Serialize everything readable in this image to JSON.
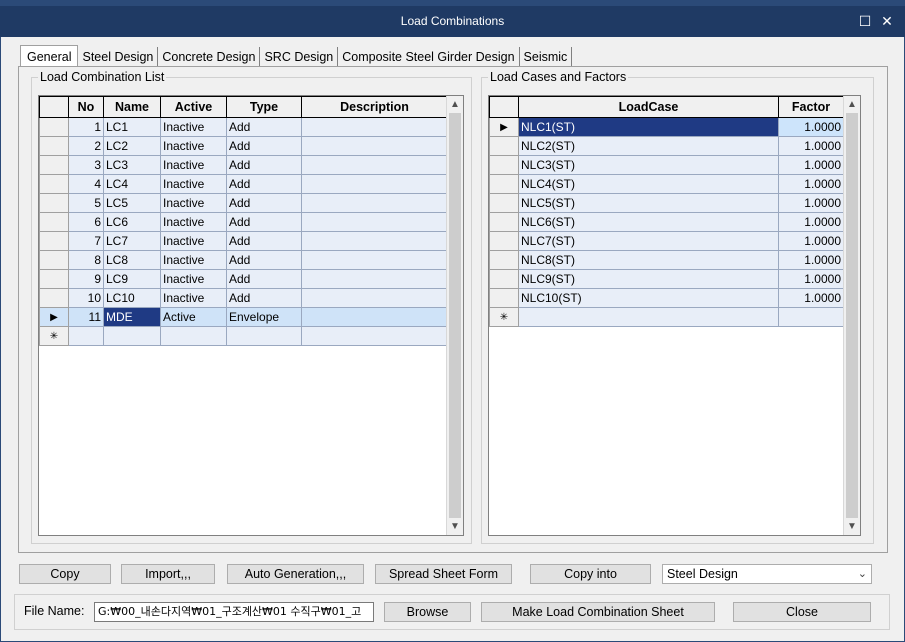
{
  "window": {
    "title": "Load Combinations"
  },
  "tabs": [
    "General",
    "Steel Design",
    "Concrete Design",
    "SRC Design",
    "Composite Steel Girder Design",
    "Seismic"
  ],
  "combo_list": {
    "label": "Load Combination List",
    "columns": [
      "No",
      "Name",
      "Active",
      "Type",
      "Description"
    ],
    "rows": [
      {
        "no": "1",
        "name": "LC1",
        "active": "Inactive",
        "type": "Add",
        "desc": ""
      },
      {
        "no": "2",
        "name": "LC2",
        "active": "Inactive",
        "type": "Add",
        "desc": ""
      },
      {
        "no": "3",
        "name": "LC3",
        "active": "Inactive",
        "type": "Add",
        "desc": ""
      },
      {
        "no": "4",
        "name": "LC4",
        "active": "Inactive",
        "type": "Add",
        "desc": ""
      },
      {
        "no": "5",
        "name": "LC5",
        "active": "Inactive",
        "type": "Add",
        "desc": ""
      },
      {
        "no": "6",
        "name": "LC6",
        "active": "Inactive",
        "type": "Add",
        "desc": ""
      },
      {
        "no": "7",
        "name": "LC7",
        "active": "Inactive",
        "type": "Add",
        "desc": ""
      },
      {
        "no": "8",
        "name": "LC8",
        "active": "Inactive",
        "type": "Add",
        "desc": ""
      },
      {
        "no": "9",
        "name": "LC9",
        "active": "Inactive",
        "type": "Add",
        "desc": ""
      },
      {
        "no": "10",
        "name": "LC10",
        "active": "Inactive",
        "type": "Add",
        "desc": ""
      },
      {
        "no": "11",
        "name": "MDE",
        "active": "Active",
        "type": "Envelope",
        "desc": ""
      }
    ],
    "selected_row": 10
  },
  "cases": {
    "label": "Load Cases and Factors",
    "columns": [
      "LoadCase",
      "Factor"
    ],
    "rows": [
      {
        "case": "NLC1(ST)",
        "factor": "1.0000"
      },
      {
        "case": "NLC2(ST)",
        "factor": "1.0000"
      },
      {
        "case": "NLC3(ST)",
        "factor": "1.0000"
      },
      {
        "case": "NLC4(ST)",
        "factor": "1.0000"
      },
      {
        "case": "NLC5(ST)",
        "factor": "1.0000"
      },
      {
        "case": "NLC6(ST)",
        "factor": "1.0000"
      },
      {
        "case": "NLC7(ST)",
        "factor": "1.0000"
      },
      {
        "case": "NLC8(ST)",
        "factor": "1.0000"
      },
      {
        "case": "NLC9(ST)",
        "factor": "1.0000"
      },
      {
        "case": "NLC10(ST)",
        "factor": "1.0000"
      }
    ],
    "selected_row": 0
  },
  "buttons": {
    "copy": "Copy",
    "import": "Import,,,",
    "auto_gen": "Auto Generation,,,",
    "spread": "Spread Sheet Form",
    "copy_into": "Copy into",
    "copy_into_target": "Steel Design",
    "browse": "Browse",
    "make_sheet": "Make Load Combination Sheet",
    "close": "Close"
  },
  "file": {
    "label": "File Name:",
    "value": "G:₩00_내손다지역₩01_구조계산₩01 수직구₩01_고"
  },
  "glyphs": {
    "row_pointer": "▶",
    "new_row": "✳",
    "scroll_up": "▲",
    "scroll_down": "▼",
    "combo_down": "⌄",
    "maximize": "☐",
    "close": "✕"
  }
}
